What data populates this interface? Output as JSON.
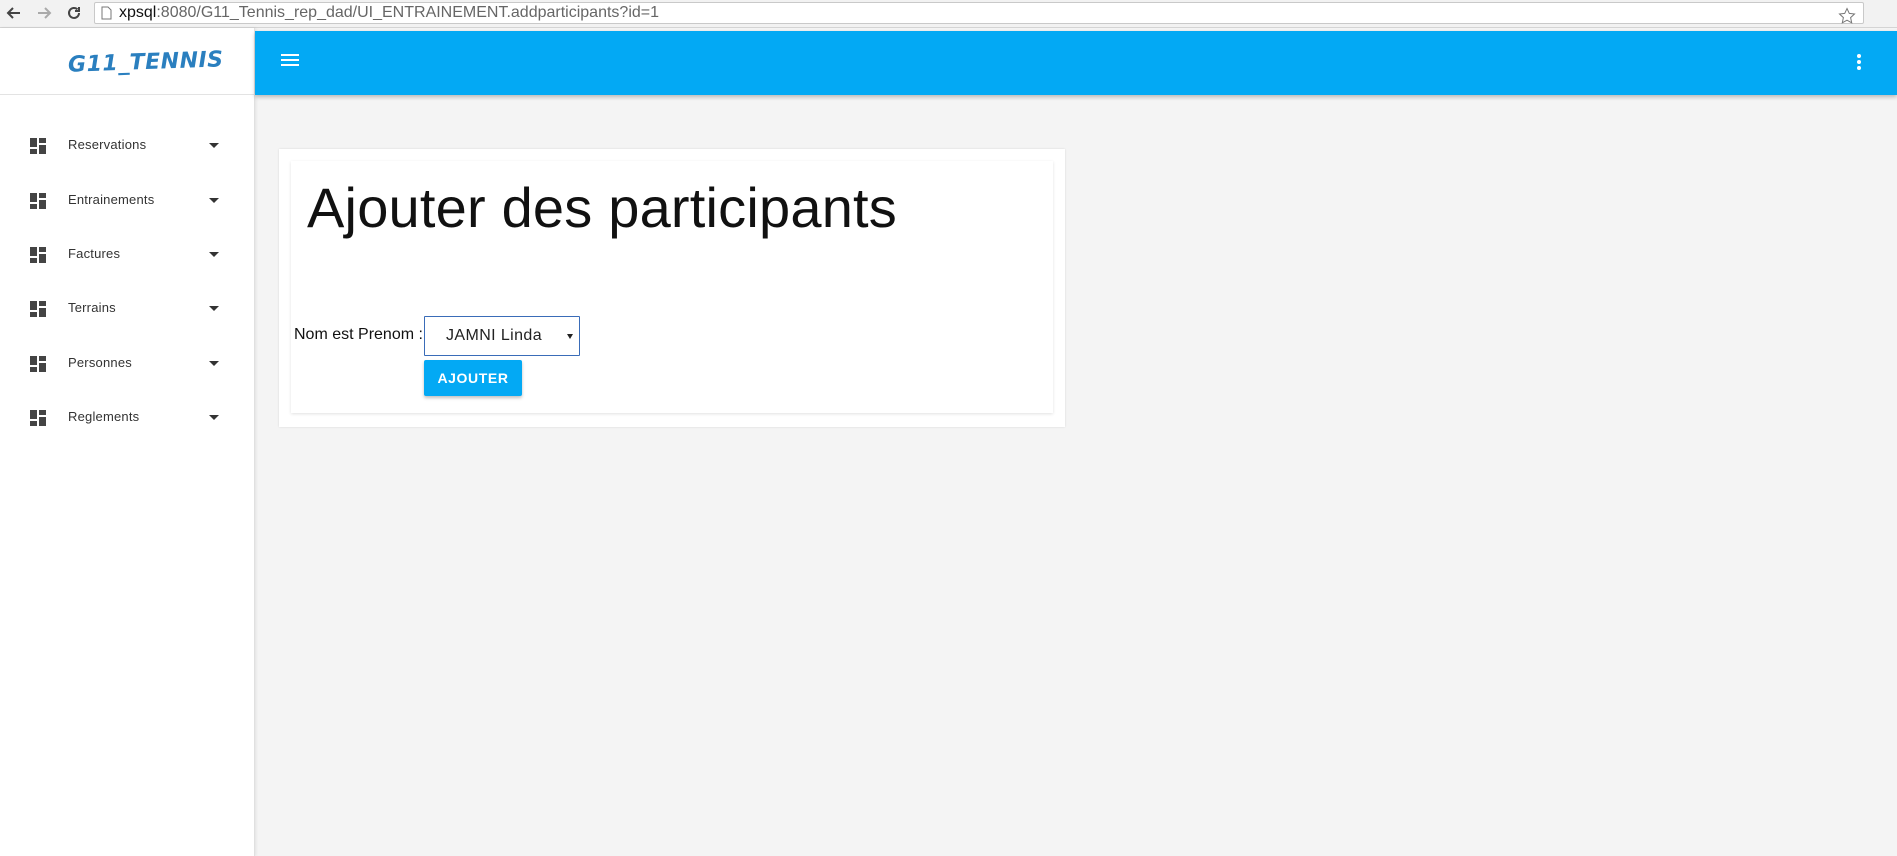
{
  "browser": {
    "url_host": "xpsql",
    "url_rest": ":8080/G11_Tennis_rep_dad/UI_ENTRAINEMENT.addparticipants?id=1"
  },
  "sidebar": {
    "logo": "G11_TENNIS",
    "items": [
      {
        "label": "Reservations",
        "icon": "dashboard-icon"
      },
      {
        "label": "Entrainements",
        "icon": "dashboard-icon"
      },
      {
        "label": "Factures",
        "icon": "dashboard-icon"
      },
      {
        "label": "Terrains",
        "icon": "dashboard-icon"
      },
      {
        "label": "Personnes",
        "icon": "dashboard-icon"
      },
      {
        "label": "Reglements",
        "icon": "dashboard-icon"
      }
    ]
  },
  "header": {
    "menu_icon": "hamburger-icon",
    "more_icon": "more-vert-icon"
  },
  "main": {
    "title": "Ajouter des participants",
    "field_label": "Nom est Prenom :",
    "select_value": "JAMNI Linda",
    "add_button": "AJOUTER"
  },
  "colors": {
    "accent": "#03a9f4",
    "logo": "#2a7fbf"
  }
}
